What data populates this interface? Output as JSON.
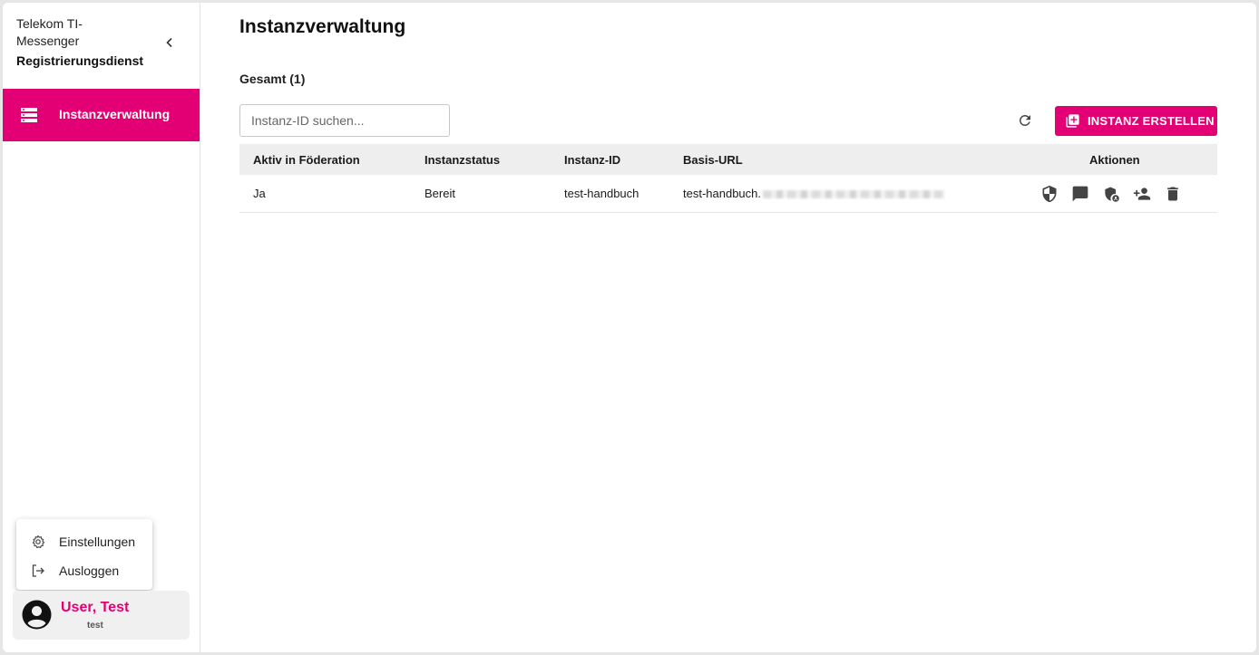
{
  "sidebar": {
    "brand_line1": "Telekom TI-",
    "brand_line2": "Messenger",
    "brand_line3": "Registrierungsdienst",
    "nav_active_label": "Instanzverwaltung",
    "user_menu": {
      "settings_label": "Einstellungen",
      "logout_label": "Ausloggen"
    },
    "user": {
      "name": "User, Test",
      "username": "test"
    }
  },
  "main": {
    "title": "Instanzverwaltung",
    "total_label": "Gesamt (1)",
    "search_placeholder": "Instanz-ID suchen...",
    "create_button_label": "INSTANZ ERSTELLEN",
    "table": {
      "columns": [
        "Aktiv in Föderation",
        "Instanzstatus",
        "Instanz-ID",
        "Basis-URL",
        "Aktionen"
      ],
      "rows": [
        {
          "active": "Ja",
          "status": "Bereit",
          "instance_id": "test-handbuch",
          "base_url": "test-handbuch."
        }
      ]
    }
  },
  "colors": {
    "brand": "#e20074",
    "icon_gray": "#444444"
  },
  "icons": {
    "collapse": "chevron-left-icon",
    "nav": "server-list-icon",
    "settings": "gear-icon",
    "logout": "logout-icon",
    "avatar": "account-circle-icon",
    "refresh": "refresh-icon",
    "create": "add-box-icon",
    "actions": [
      "shield-icon",
      "chat-icon",
      "admin-shield-icon",
      "add-user-icon",
      "delete-icon"
    ]
  }
}
